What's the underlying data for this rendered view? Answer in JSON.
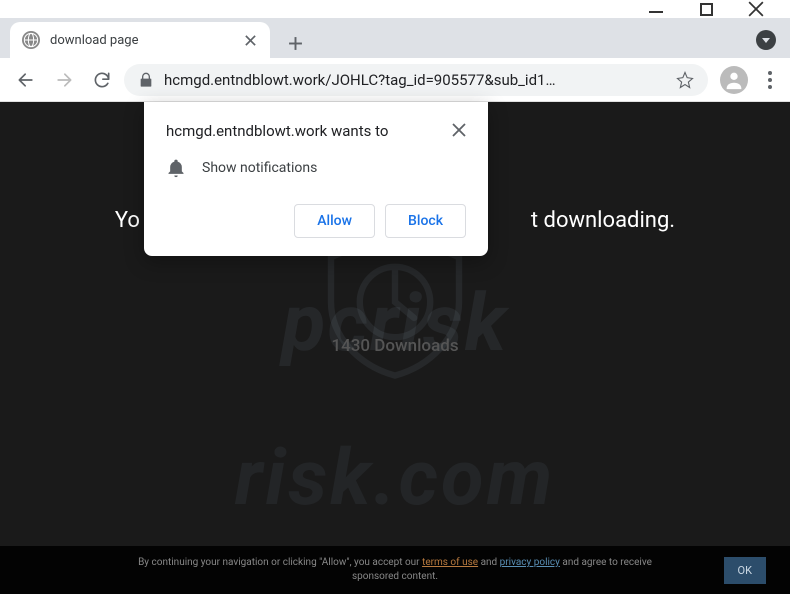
{
  "tab": {
    "title": "download page"
  },
  "url": "hcmgd.entndblowt.work/JOHLC?tag_id=905577&sub_id1…",
  "page": {
    "banner_left": "Yo",
    "banner_right": "t downloading.",
    "downloads": "1430 Downloads"
  },
  "cookie": {
    "pre": "By continuing your navigation or clicking \"Allow\", you accept our ",
    "link1": "terms of use",
    "mid": " and ",
    "link2": "privacy policy",
    "post": " and agree to receive sponsored content.",
    "ok": "OK"
  },
  "perm": {
    "title": "hcmgd.entndblowt.work wants to",
    "label": "Show notifications",
    "allow": "Allow",
    "block": "Block"
  },
  "watermark": {
    "line1": "pcrisk",
    "line2": "risk.com"
  }
}
